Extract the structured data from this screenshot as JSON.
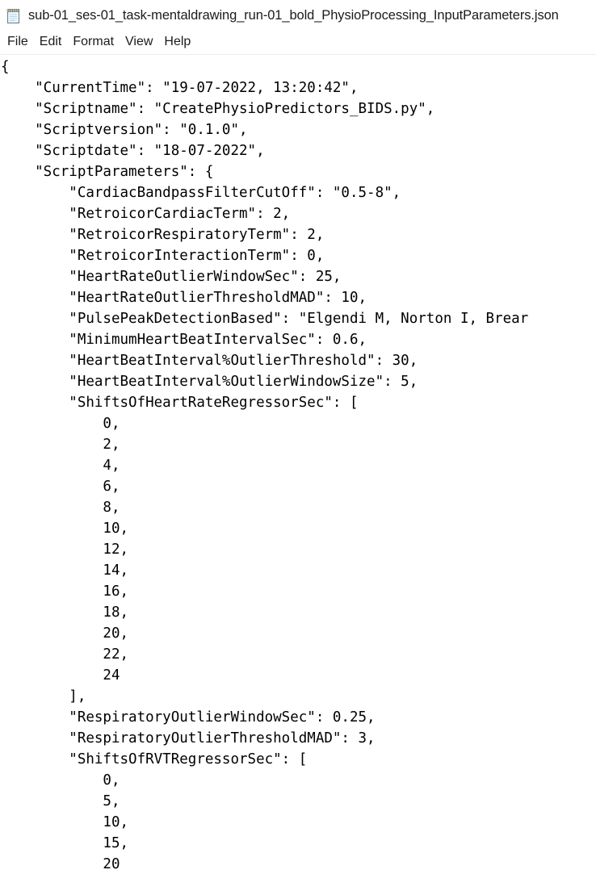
{
  "window": {
    "title": "sub-01_ses-01_task-mentaldrawing_run-01_bold_PhysioProcessing_InputParameters.json",
    "app_icon": "notepad-icon",
    "background_color": "#ffffff",
    "text_color": "#000000"
  },
  "menu": {
    "items": [
      {
        "label": "File"
      },
      {
        "label": "Edit"
      },
      {
        "label": "Format"
      },
      {
        "label": "View"
      },
      {
        "label": "Help"
      }
    ]
  },
  "document": {
    "lines": [
      "{",
      "    \"CurrentTime\": \"19-07-2022, 13:20:42\",",
      "    \"Scriptname\": \"CreatePhysioPredictors_BIDS.py\",",
      "    \"Scriptversion\": \"0.1.0\",",
      "    \"Scriptdate\": \"18-07-2022\",",
      "    \"ScriptParameters\": {",
      "        \"CardiacBandpassFilterCutOff\": \"0.5-8\",",
      "        \"RetroicorCardiacTerm\": 2,",
      "        \"RetroicorRespiratoryTerm\": 2,",
      "        \"RetroicorInteractionTerm\": 0,",
      "        \"HeartRateOutlierWindowSec\": 25,",
      "        \"HeartRateOutlierThresholdMAD\": 10,",
      "        \"PulsePeakDetectionBased\": \"Elgendi M, Norton I, Brear",
      "        \"MinimumHeartBeatIntervalSec\": 0.6,",
      "        \"HeartBeatInterval%OutlierThreshold\": 30,",
      "        \"HeartBeatInterval%OutlierWindowSize\": 5,",
      "        \"ShiftsOfHeartRateRegressorSec\": [",
      "            0,",
      "            2,",
      "            4,",
      "            6,",
      "            8,",
      "            10,",
      "            12,",
      "            14,",
      "            16,",
      "            18,",
      "            20,",
      "            22,",
      "            24",
      "        ],",
      "        \"RespiratoryOutlierWindowSec\": 0.25,",
      "        \"RespiratoryOutlierThresholdMAD\": 3,",
      "        \"ShiftsOfRVTRegressorSec\": [",
      "            0,",
      "            5,",
      "            10,",
      "            15,",
      "            20"
    ]
  }
}
